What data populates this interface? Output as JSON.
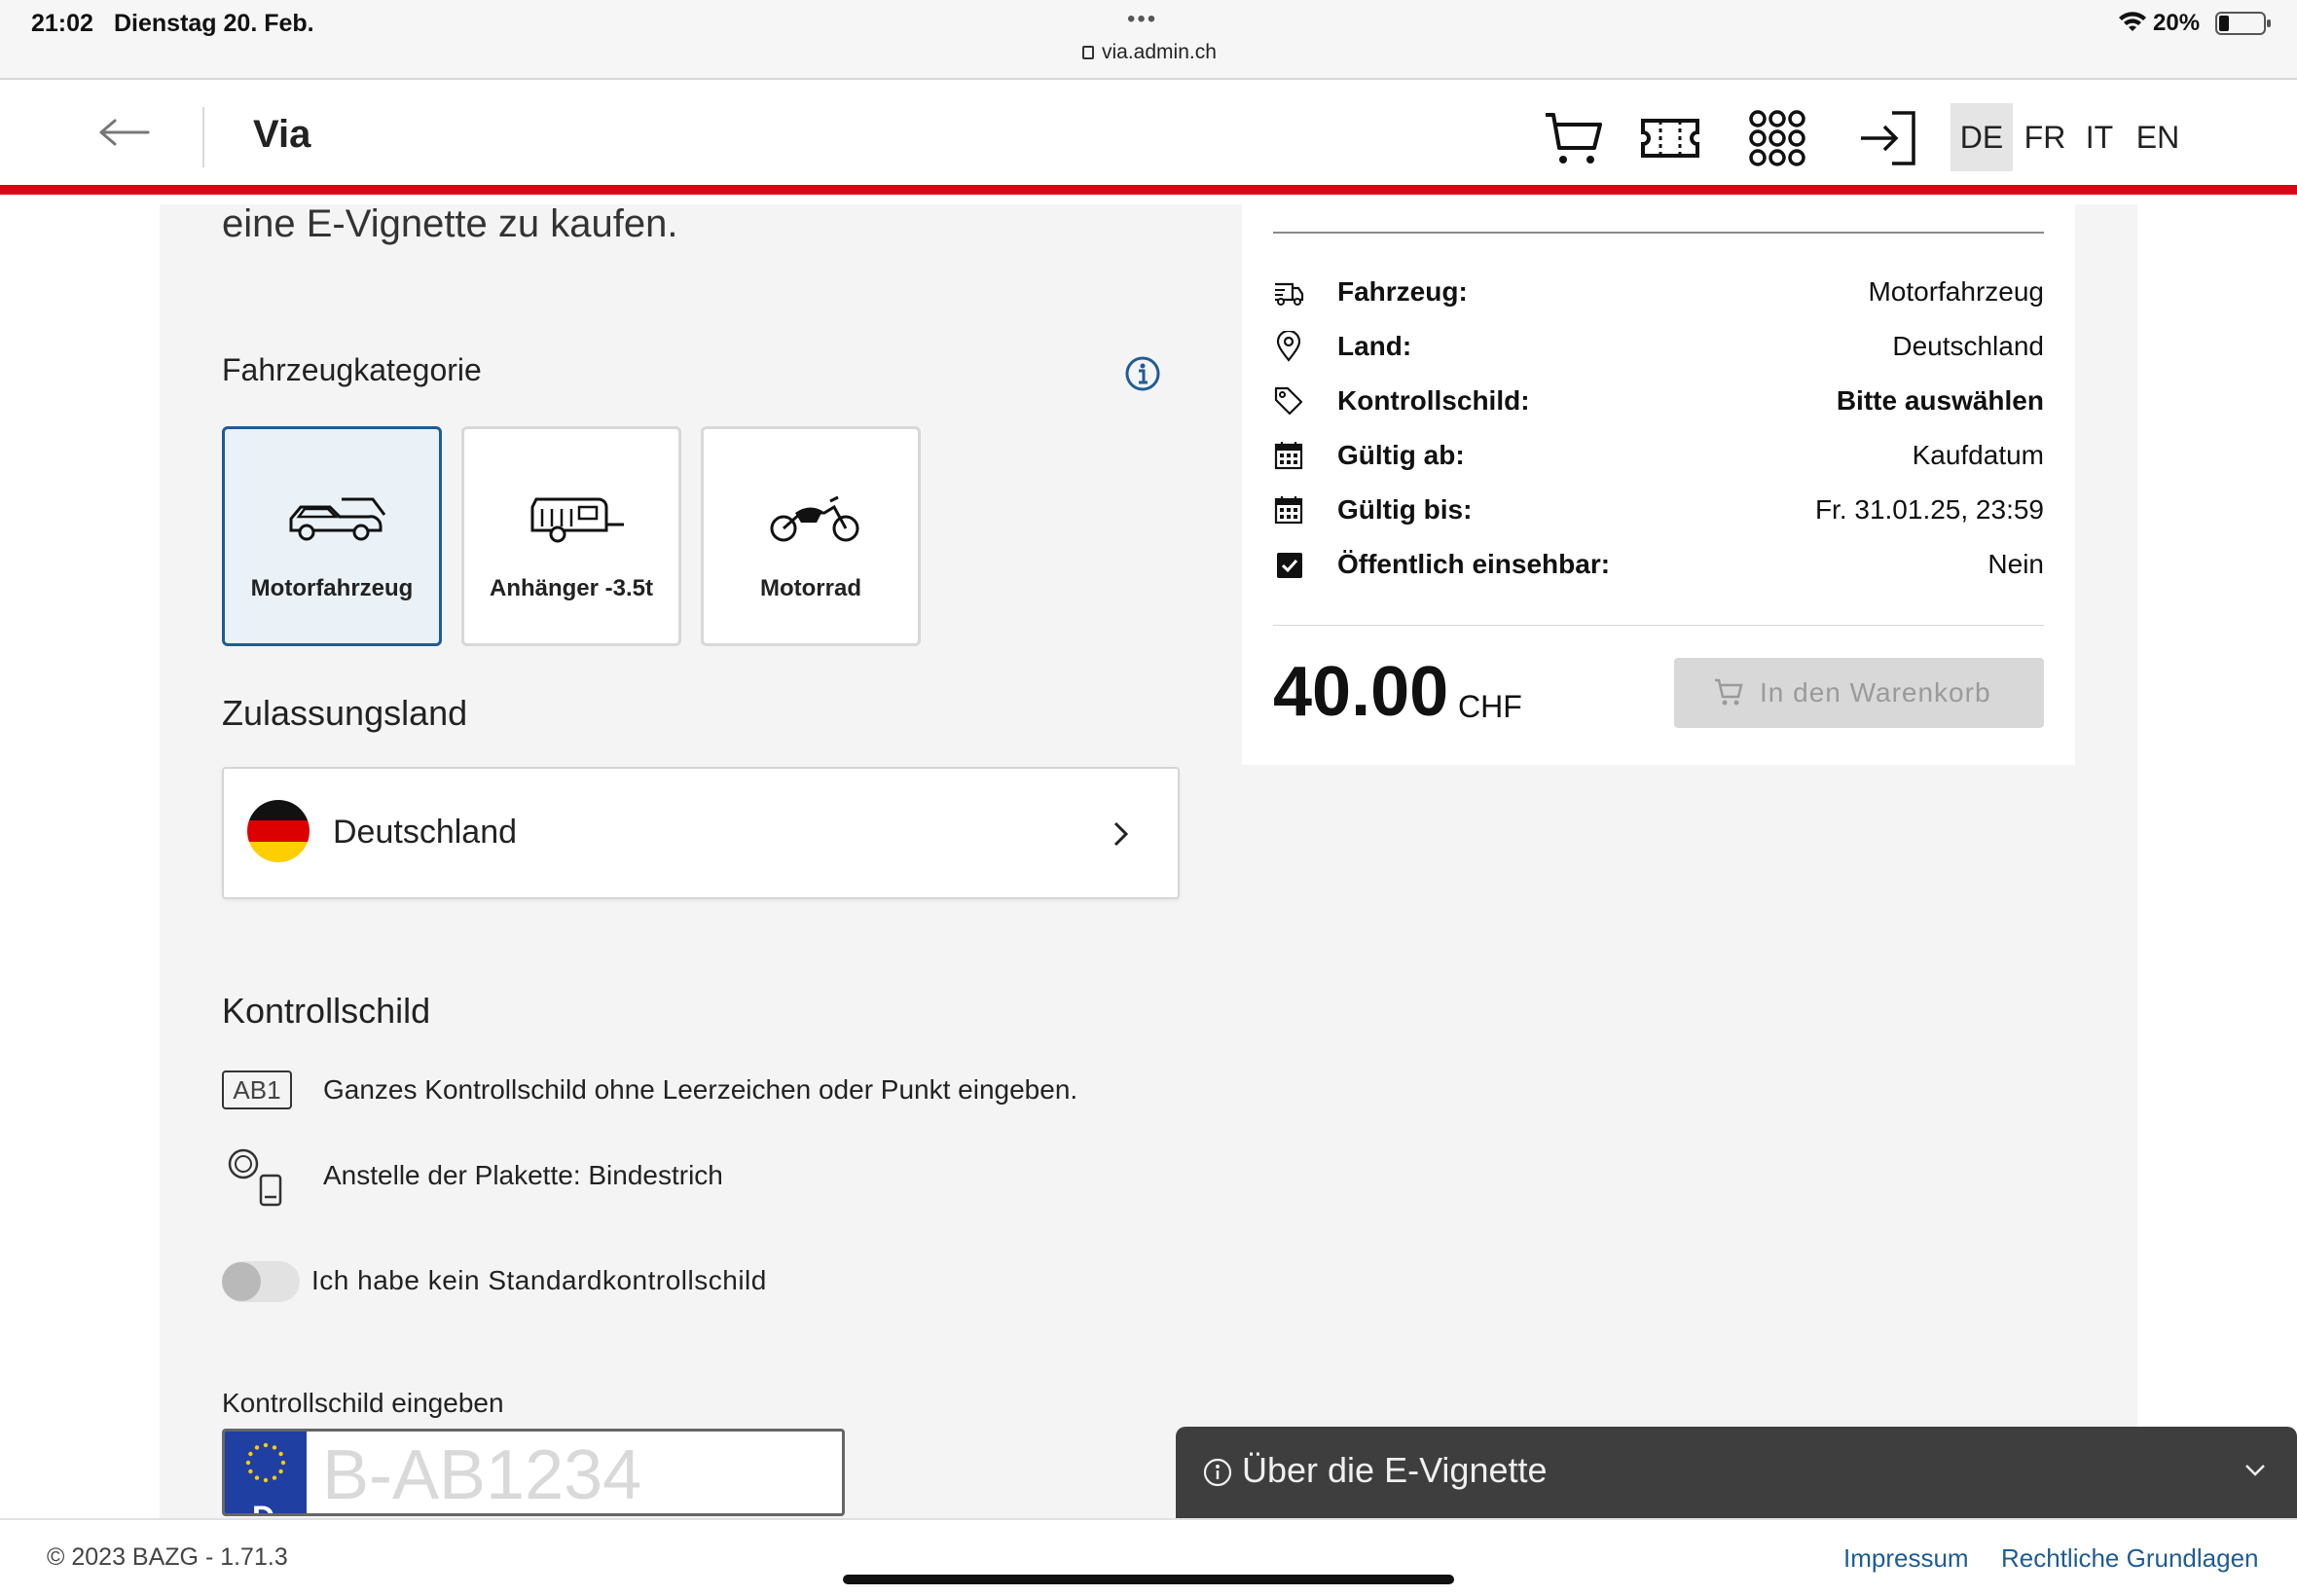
{
  "status_bar": {
    "time": "21:02",
    "date": "Dienstag 20. Feb.",
    "dots": "•••",
    "url": "via.admin.ch",
    "battery": "20%"
  },
  "header": {
    "title": "Via",
    "icons": [
      "cart-icon",
      "ticket-icon",
      "apps-grid-icon",
      "login-icon"
    ],
    "languages": [
      "DE",
      "FR",
      "IT",
      "EN"
    ],
    "active_language": "DE"
  },
  "main": {
    "intro_text": "eine E-Vignette zu kaufen.",
    "vehicle_category_label": "Fahrzeugkategorie",
    "vehicle_categories": [
      {
        "label": "Motorfahrzeug",
        "icon": "car-icon",
        "selected": true
      },
      {
        "label": "Anhänger -3.5t",
        "icon": "trailer-icon",
        "selected": false
      },
      {
        "label": "Motorrad",
        "icon": "motorcycle-icon",
        "selected": false
      }
    ],
    "country_label": "Zulassungsland",
    "country": "Deutschland",
    "plate_section_label": "Kontrollschild",
    "plate_hint_icon_text": "AB1",
    "plate_hint_1": "Ganzes Kontrollschild ohne Leerzeichen oder Punkt eingeben.",
    "plate_hint_2": "Anstelle der Plakette: Bindestrich",
    "toggle_label": "Ich habe kein Standardkontrollschild",
    "plate_input_label": "Kontrollschild eingeben",
    "plate_input_placeholder": "B-AB1234",
    "plate_country_letter": "D"
  },
  "summary": {
    "rows": [
      {
        "key": "Fahrzeug:",
        "value": "Motorfahrzeug",
        "icon": "truck-icon"
      },
      {
        "key": "Land:",
        "value": "Deutschland",
        "icon": "location-pin-icon"
      },
      {
        "key": "Kontrollschild:",
        "value": "Bitte auswählen",
        "icon": "tag-icon"
      },
      {
        "key": "Gültig ab:",
        "value": "Kaufdatum",
        "icon": "calendar-icon"
      },
      {
        "key": "Gültig bis:",
        "value": "Fr. 31.01.25, 23:59",
        "icon": "calendar-icon"
      },
      {
        "key": "Öffentlich einsehbar:",
        "value": "Nein",
        "icon": "checkbox-checked-icon"
      }
    ],
    "price": "40.00",
    "currency": "CHF",
    "cart_button": "In den Warenkorb"
  },
  "about_panel": {
    "label": "Über die E-Vignette"
  },
  "footer": {
    "copyright": "© 2023 BAZG - 1.71.3",
    "links": [
      "Impressum",
      "Rechtliche Grundlagen"
    ]
  },
  "colors": {
    "accent_red": "#dc0018",
    "primary_blue": "#1f5c94",
    "panel_grey": "#f4f4f4",
    "about_panel_bg": "#3e3e3e"
  }
}
